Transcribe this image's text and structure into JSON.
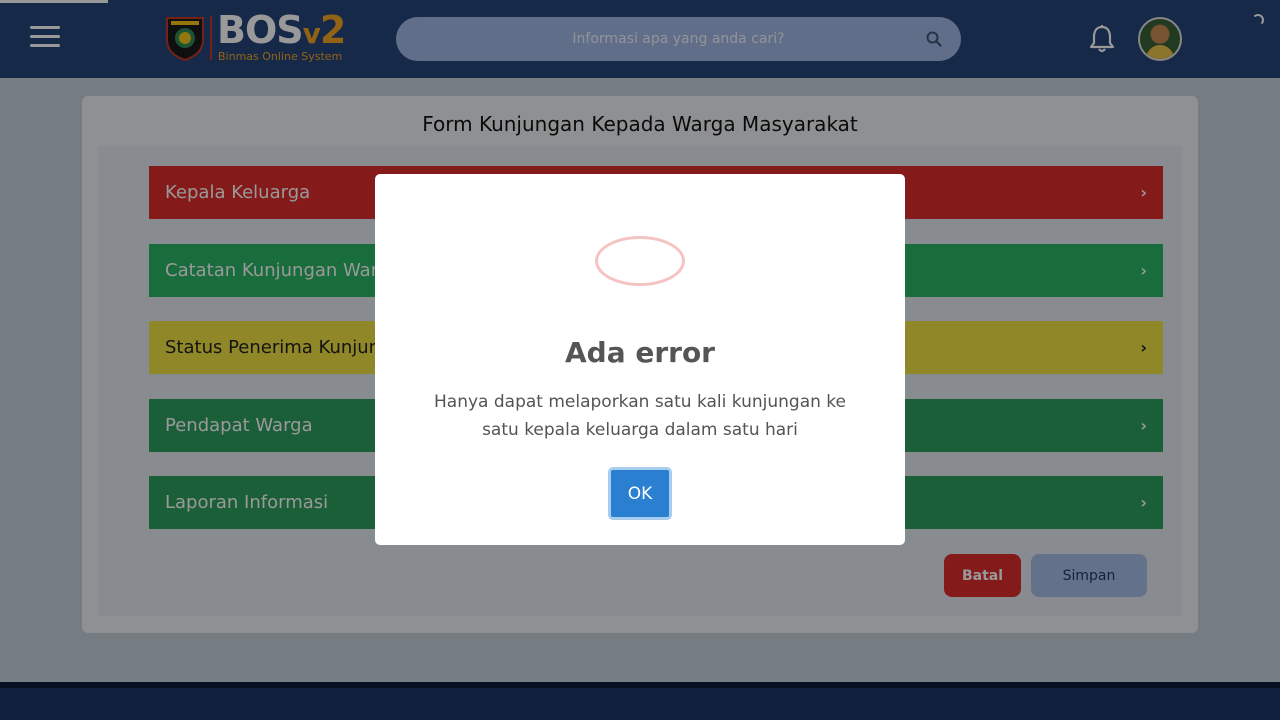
{
  "header": {
    "brand_main": "BOS",
    "brand_v": "v",
    "brand_num": "2",
    "tagline": "Binmas Online System",
    "search_placeholder": "Informasi apa yang anda cari?"
  },
  "form": {
    "title": "Form Kunjungan Kepada Warga Masyarakat",
    "sections": [
      {
        "label": "Kepala Keluarga",
        "color": "#de2c2c"
      },
      {
        "label": "Catatan Kunjungan Warga",
        "color": "#2ab565"
      },
      {
        "label": "Status Penerima Kunjungan",
        "color": "#f1e143"
      },
      {
        "label": "Pendapat Warga",
        "color": "#2d9f5f"
      },
      {
        "label": "Laporan Informasi",
        "color": "#2d9f5f"
      }
    ],
    "chevron": "›",
    "cancel_label": "Batal",
    "save_label": "Simpan"
  },
  "dialog": {
    "title": "Ada error",
    "message": "Hanya dapat melaporkan satu kali kunjungan ke satu kepala keluarga dalam satu hari",
    "ok_label": "OK",
    "icon": "error-icon"
  },
  "icons": {
    "menu": "hamburger-menu-icon",
    "search": "search-icon",
    "notification": "bell-icon"
  }
}
